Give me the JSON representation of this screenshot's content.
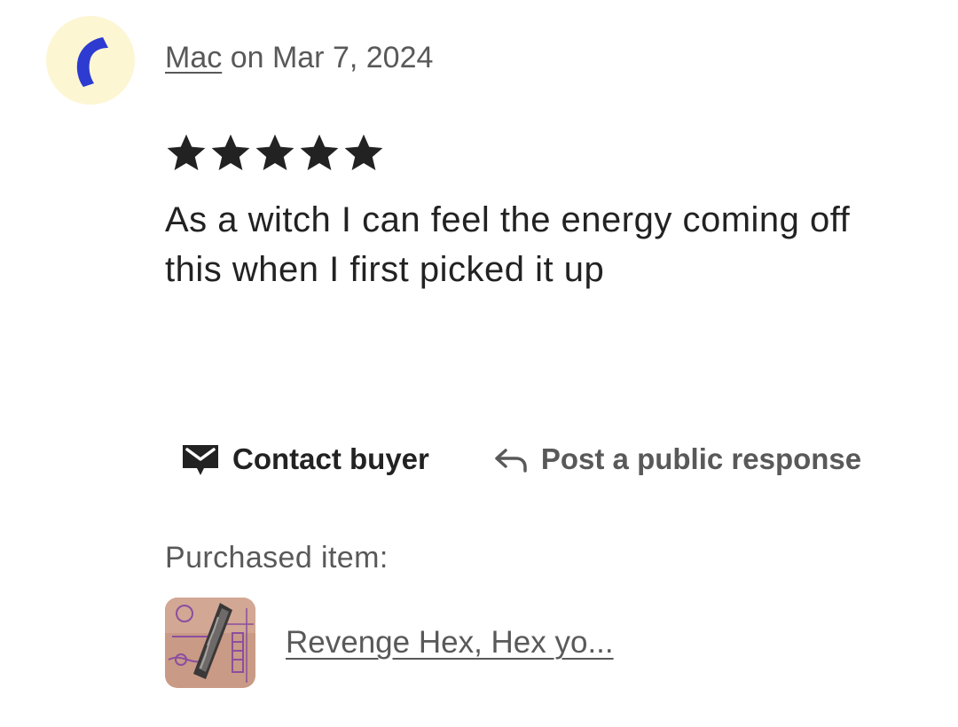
{
  "review": {
    "author": "Mac",
    "date_text": "on Mar 7, 2024",
    "rating": 5,
    "rating_max": 5,
    "text": "As a witch I can feel the energy coming off this when I first picked it up"
  },
  "actions": {
    "contact_label": "Contact buyer",
    "respond_label": "Post a public response"
  },
  "purchased": {
    "label": "Purchased item:",
    "item_title": "Revenge Hex, Hex yo..."
  },
  "colors": {
    "avatar_bg": "#fdf6d3",
    "avatar_mark": "#2d3bd1",
    "text_primary": "#222222",
    "text_secondary": "#595959"
  },
  "icons": {
    "avatar": "crescent-mark-icon",
    "contact": "mail-icon",
    "respond": "reply-arrow-icon",
    "rating": "star-icon"
  }
}
